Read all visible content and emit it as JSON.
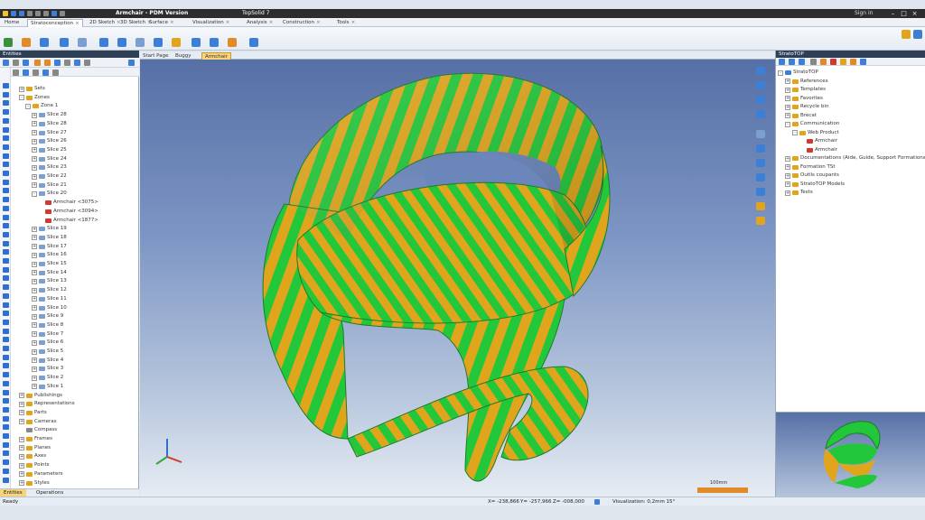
{
  "window": {
    "title": "Armchair - PDM Version",
    "document": "TopSolid 7",
    "sign_in": "Sign in"
  },
  "ribbon_tabs": [
    {
      "label": "Home"
    },
    {
      "label": "Stratoconception",
      "active": true
    },
    {
      "label": "2D Sketch"
    },
    {
      "label": "3D Sketch"
    },
    {
      "label": "Surface"
    },
    {
      "label": "Visualization"
    },
    {
      "label": "Analysis"
    },
    {
      "label": "Construction"
    },
    {
      "label": "Tools"
    }
  ],
  "left_panel": {
    "title": "Entities",
    "tree": [
      {
        "label": "Sets",
        "indent": 1,
        "exp": "+",
        "icon": "folder"
      },
      {
        "label": "Zones",
        "indent": 1,
        "exp": "-",
        "icon": "folder"
      },
      {
        "label": "Zone 1",
        "indent": 2,
        "exp": "-",
        "icon": "folder"
      },
      {
        "label": "Slice 28",
        "indent": 3,
        "exp": "+",
        "icon": "slice"
      },
      {
        "label": "Slice 28",
        "indent": 3,
        "exp": "+",
        "icon": "slice"
      },
      {
        "label": "Slice 27",
        "indent": 3,
        "exp": "+",
        "icon": "slice"
      },
      {
        "label": "Slice 26",
        "indent": 3,
        "exp": "+",
        "icon": "slice"
      },
      {
        "label": "Slice 25",
        "indent": 3,
        "exp": "+",
        "icon": "slice"
      },
      {
        "label": "Slice 24",
        "indent": 3,
        "exp": "+",
        "icon": "slice"
      },
      {
        "label": "Slice 23",
        "indent": 3,
        "exp": "+",
        "icon": "slice"
      },
      {
        "label": "Slice 22",
        "indent": 3,
        "exp": "+",
        "icon": "slice"
      },
      {
        "label": "Slice 21",
        "indent": 3,
        "exp": "+",
        "icon": "slice"
      },
      {
        "label": "Slice 20",
        "indent": 3,
        "exp": "-",
        "icon": "slice"
      },
      {
        "label": "Armchair <3075>",
        "indent": 4,
        "exp": "",
        "icon": "part"
      },
      {
        "label": "Armchair <3094>",
        "indent": 4,
        "exp": "",
        "icon": "part"
      },
      {
        "label": "Armchair <1877>",
        "indent": 4,
        "exp": "",
        "icon": "part"
      },
      {
        "label": "Slice 19",
        "indent": 3,
        "exp": "+",
        "icon": "slice"
      },
      {
        "label": "Slice 18",
        "indent": 3,
        "exp": "+",
        "icon": "slice"
      },
      {
        "label": "Slice 17",
        "indent": 3,
        "exp": "+",
        "icon": "slice"
      },
      {
        "label": "Slice 16",
        "indent": 3,
        "exp": "+",
        "icon": "slice"
      },
      {
        "label": "Slice 15",
        "indent": 3,
        "exp": "+",
        "icon": "slice"
      },
      {
        "label": "Slice 14",
        "indent": 3,
        "exp": "+",
        "icon": "slice"
      },
      {
        "label": "Slice 13",
        "indent": 3,
        "exp": "+",
        "icon": "slice"
      },
      {
        "label": "Slice 12",
        "indent": 3,
        "exp": "+",
        "icon": "slice"
      },
      {
        "label": "Slice 11",
        "indent": 3,
        "exp": "+",
        "icon": "slice"
      },
      {
        "label": "Slice 10",
        "indent": 3,
        "exp": "+",
        "icon": "slice"
      },
      {
        "label": "Slice 9",
        "indent": 3,
        "exp": "+",
        "icon": "slice"
      },
      {
        "label": "Slice 8",
        "indent": 3,
        "exp": "+",
        "icon": "slice"
      },
      {
        "label": "Slice 7",
        "indent": 3,
        "exp": "+",
        "icon": "slice"
      },
      {
        "label": "Slice 6",
        "indent": 3,
        "exp": "+",
        "icon": "slice"
      },
      {
        "label": "Slice 5",
        "indent": 3,
        "exp": "+",
        "icon": "slice"
      },
      {
        "label": "Slice 4",
        "indent": 3,
        "exp": "+",
        "icon": "slice"
      },
      {
        "label": "Slice 3",
        "indent": 3,
        "exp": "+",
        "icon": "slice"
      },
      {
        "label": "Slice 2",
        "indent": 3,
        "exp": "+",
        "icon": "slice"
      },
      {
        "label": "Slice 1",
        "indent": 3,
        "exp": "+",
        "icon": "slice"
      },
      {
        "label": "Publishings",
        "indent": 1,
        "exp": "+",
        "icon": "folder"
      },
      {
        "label": "Representations",
        "indent": 1,
        "exp": "+",
        "icon": "folder"
      },
      {
        "label": "Parts",
        "indent": 1,
        "exp": "+",
        "icon": "folder"
      },
      {
        "label": "Cameras",
        "indent": 1,
        "exp": "+",
        "icon": "folder"
      },
      {
        "label": "Compass",
        "indent": 1,
        "exp": "",
        "icon": "compass"
      },
      {
        "label": "Frames",
        "indent": 1,
        "exp": "+",
        "icon": "folder"
      },
      {
        "label": "Planes",
        "indent": 1,
        "exp": "+",
        "icon": "folder"
      },
      {
        "label": "Axes",
        "indent": 1,
        "exp": "+",
        "icon": "folder"
      },
      {
        "label": "Points",
        "indent": 1,
        "exp": "+",
        "icon": "folder"
      },
      {
        "label": "Parameters",
        "indent": 1,
        "exp": "+",
        "icon": "folder"
      },
      {
        "label": "Styles",
        "indent": 1,
        "exp": "+",
        "icon": "folder"
      }
    ],
    "tabs": [
      {
        "label": "Entities",
        "active": true
      },
      {
        "label": "Operations"
      }
    ]
  },
  "doc_tabs": [
    {
      "label": "Start Page"
    },
    {
      "label": "Buggy"
    },
    {
      "label": "Armchair",
      "active": true
    }
  ],
  "viewport": {
    "scale_label": "100mm",
    "colors": {
      "stripe_green": "#22c83a",
      "stripe_orange": "#e0a51c",
      "bg_top": "#5670a6",
      "bg_bottom": "#e6ecf3"
    }
  },
  "right_panel": {
    "title": "StratoTOP",
    "tree": [
      {
        "label": "StratoTOP",
        "indent": 0,
        "exp": "-",
        "icon": "db"
      },
      {
        "label": "References",
        "indent": 1,
        "exp": "+",
        "icon": "folder"
      },
      {
        "label": "Templates",
        "indent": 1,
        "exp": "+",
        "icon": "folder"
      },
      {
        "label": "Favorites",
        "indent": 1,
        "exp": "+",
        "icon": "folder"
      },
      {
        "label": "Recycle bin",
        "indent": 1,
        "exp": "+",
        "icon": "folder"
      },
      {
        "label": "Brecat",
        "indent": 1,
        "exp": "+",
        "icon": "folder"
      },
      {
        "label": "Communication",
        "indent": 1,
        "exp": "-",
        "icon": "folder"
      },
      {
        "label": "Web Product",
        "indent": 2,
        "exp": "-",
        "icon": "folder"
      },
      {
        "label": "Armchair",
        "indent": 3,
        "exp": "",
        "icon": "part"
      },
      {
        "label": "Armchair",
        "indent": 3,
        "exp": "",
        "icon": "part"
      },
      {
        "label": "Documentations (Aide, Guide, Support Formations)",
        "indent": 1,
        "exp": "+",
        "icon": "folder"
      },
      {
        "label": "Formation TSt",
        "indent": 1,
        "exp": "+",
        "icon": "folder"
      },
      {
        "label": "Outils coupants",
        "indent": 1,
        "exp": "+",
        "icon": "folder"
      },
      {
        "label": "StratoTOP Models",
        "indent": 1,
        "exp": "+",
        "icon": "folder"
      },
      {
        "label": "Tests",
        "indent": 1,
        "exp": "+",
        "icon": "folder"
      }
    ]
  },
  "status": {
    "ready": "Ready",
    "x": "X= -238,866",
    "y": "Y= -257,966",
    "z": "Z= -008,000",
    "visualization": "Visualization: 0,2mm 15°"
  }
}
